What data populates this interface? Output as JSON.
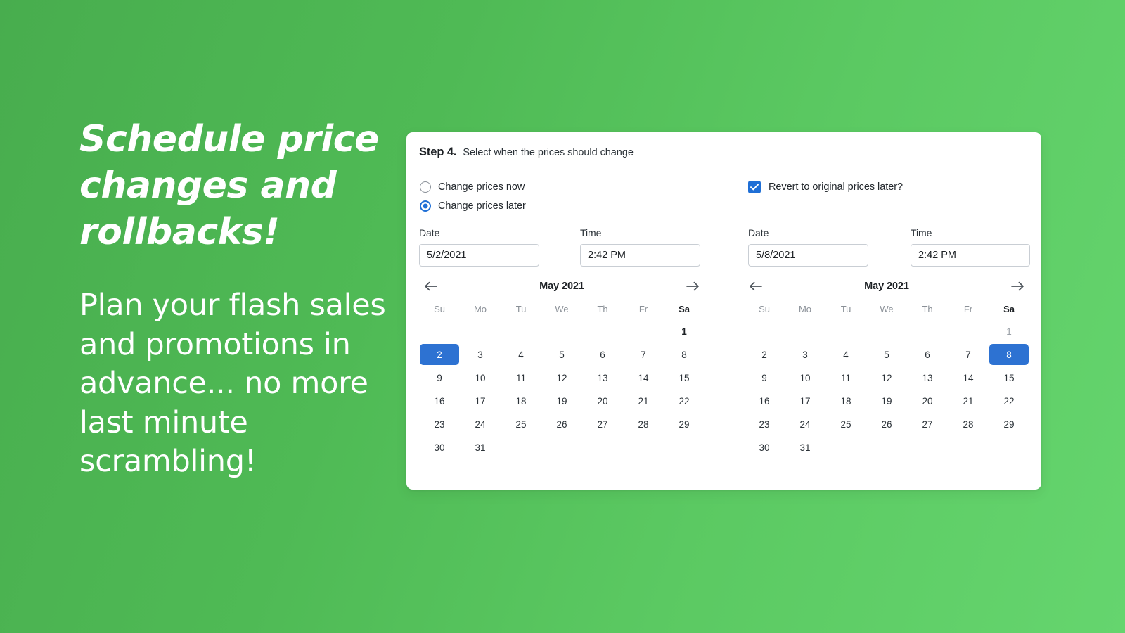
{
  "background": {
    "from": "#48ad4e",
    "to": "#65d56e"
  },
  "promo": {
    "headline": "Schedule price changes and rollbacks!",
    "body": "Plan your flash sales and promotions in advance... no more last minute scrambling!"
  },
  "card": {
    "step_label": "Step 4.",
    "step_description": "Select when the prices should change",
    "accent_color": "#2d72d2",
    "options": [
      {
        "label": "Change prices now",
        "selected": false
      },
      {
        "label": "Change prices later",
        "selected": true
      }
    ],
    "revert": {
      "label": "Revert to original prices later?",
      "checked": true
    },
    "start": {
      "date_label": "Date",
      "date_value": "5/2/2021",
      "date_placeholder": "M/D/YYYY",
      "time_label": "Time",
      "time_value": "2:42 PM",
      "time_placeholder": "h:mm AM/PM"
    },
    "end": {
      "date_label": "Date",
      "date_value": "5/8/2021",
      "date_placeholder": "M/D/YYYY",
      "time_label": "Time",
      "time_value": "2:42 PM",
      "time_placeholder": "h:mm AM/PM"
    },
    "calendars": [
      {
        "name": "start-calendar",
        "title": "May 2021",
        "prev_icon": "arrow-left-icon",
        "next_icon": "arrow-right-icon",
        "day_names": [
          "Su",
          "Mo",
          "Tu",
          "We",
          "Th",
          "Fr",
          "Sa"
        ],
        "accent_day_index": 6,
        "leading_blanks": 6,
        "days": [
          1,
          2,
          3,
          4,
          5,
          6,
          7,
          8,
          9,
          10,
          11,
          12,
          13,
          14,
          15,
          16,
          17,
          18,
          19,
          20,
          21,
          22,
          23,
          24,
          25,
          26,
          27,
          28,
          29,
          30,
          31
        ],
        "selected_day": 2,
        "bold_days": [
          1
        ],
        "muted_days": []
      },
      {
        "name": "end-calendar",
        "title": "May 2021",
        "prev_icon": "arrow-left-icon",
        "next_icon": "arrow-right-icon",
        "day_names": [
          "Su",
          "Mo",
          "Tu",
          "We",
          "Th",
          "Fr",
          "Sa"
        ],
        "accent_day_index": 6,
        "leading_blanks": 6,
        "days": [
          1,
          2,
          3,
          4,
          5,
          6,
          7,
          8,
          9,
          10,
          11,
          12,
          13,
          14,
          15,
          16,
          17,
          18,
          19,
          20,
          21,
          22,
          23,
          24,
          25,
          26,
          27,
          28,
          29,
          30,
          31
        ],
        "selected_day": 8,
        "bold_days": [],
        "muted_days": [
          1
        ]
      }
    ]
  }
}
